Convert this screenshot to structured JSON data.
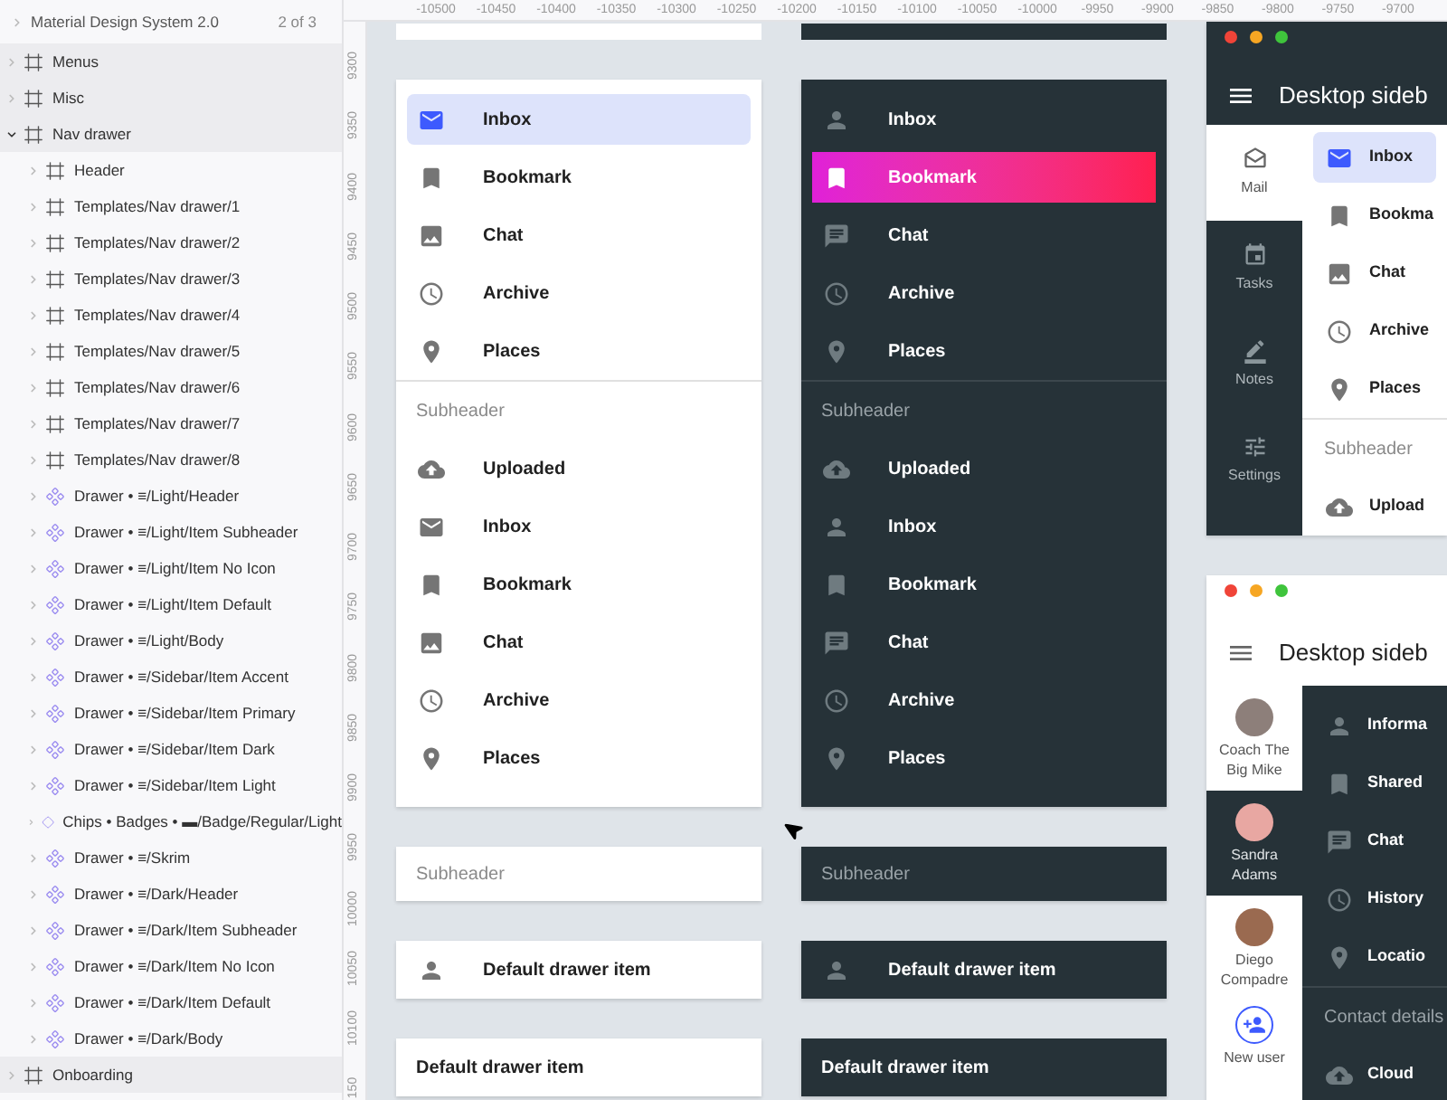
{
  "layers": {
    "title": "Material Design System 2.0",
    "page_count": "2 of 3",
    "items": [
      {
        "kind": "frame",
        "label": "Menus",
        "expanded": false
      },
      {
        "kind": "frame",
        "label": "Misc",
        "expanded": false
      },
      {
        "kind": "frame",
        "label": "Nav drawer",
        "expanded": true,
        "children": [
          {
            "kind": "frame",
            "label": "Header",
            "expanded": false
          },
          {
            "kind": "frame",
            "label": "Templates/Nav drawer/1",
            "expanded": false
          },
          {
            "kind": "frame",
            "label": "Templates/Nav drawer/2",
            "expanded": false
          },
          {
            "kind": "frame",
            "label": "Templates/Nav drawer/3",
            "expanded": false
          },
          {
            "kind": "frame",
            "label": "Templates/Nav drawer/4",
            "expanded": false
          },
          {
            "kind": "frame",
            "label": "Templates/Nav drawer/5",
            "expanded": false
          },
          {
            "kind": "frame",
            "label": "Templates/Nav drawer/6",
            "expanded": false
          },
          {
            "kind": "frame",
            "label": "Templates/Nav drawer/7",
            "expanded": false
          },
          {
            "kind": "frame",
            "label": "Templates/Nav drawer/8",
            "expanded": false
          },
          {
            "kind": "component",
            "label": "Drawer • ≡/Light/Header",
            "expanded": false
          },
          {
            "kind": "component",
            "label": "Drawer • ≡/Light/Item Subheader",
            "expanded": false
          },
          {
            "kind": "component",
            "label": "Drawer • ≡/Light/Item No Icon",
            "expanded": false
          },
          {
            "kind": "component",
            "label": "Drawer • ≡/Light/Item Default",
            "expanded": false
          },
          {
            "kind": "component",
            "label": "Drawer • ≡/Light/Body",
            "expanded": false
          },
          {
            "kind": "component",
            "label": "Drawer • ≡/Sidebar/Item Accent",
            "expanded": false
          },
          {
            "kind": "component",
            "label": "Drawer • ≡/Sidebar/Item Primary",
            "expanded": false
          },
          {
            "kind": "component",
            "label": "Drawer • ≡/Sidebar/Item Dark",
            "expanded": false
          },
          {
            "kind": "component",
            "label": "Drawer • ≡/Sidebar/Item Light",
            "expanded": false
          },
          {
            "kind": "instance",
            "label": "Chips • Badges • ▬/Badge/Regular/Light",
            "expanded": false
          },
          {
            "kind": "component",
            "label": "Drawer • ≡/Skrim",
            "expanded": false
          },
          {
            "kind": "component",
            "label": "Drawer • ≡/Dark/Header",
            "expanded": false
          },
          {
            "kind": "component",
            "label": "Drawer • ≡/Dark/Item Subheader",
            "expanded": false
          },
          {
            "kind": "component",
            "label": "Drawer • ≡/Dark/Item No Icon",
            "expanded": false
          },
          {
            "kind": "component",
            "label": "Drawer • ≡/Dark/Item Default",
            "expanded": false
          },
          {
            "kind": "component",
            "label": "Drawer • ≡/Dark/Body",
            "expanded": false
          }
        ]
      },
      {
        "kind": "frame",
        "label": "Onboarding",
        "expanded": false
      }
    ]
  },
  "ruler_top": {
    "labels": [
      "-10500",
      "-10450",
      "-10400",
      "-10350",
      "-10300",
      "-10250",
      "-10200",
      "-10150",
      "-10100",
      "-10050",
      "-10000",
      "-9950",
      "-9900",
      "-9850",
      "-9800",
      "-9750",
      "-9700"
    ]
  },
  "ruler_left": {
    "labels": [
      "9300",
      "9350",
      "9400",
      "9450",
      "9500",
      "9550",
      "9600",
      "9650",
      "9700",
      "9750",
      "9800",
      "9850",
      "9900",
      "9950",
      "10000",
      "10050",
      "10100",
      "150"
    ]
  },
  "light_drawer": {
    "groups": [
      {
        "items": [
          {
            "label": "Inbox",
            "selected": true
          },
          {
            "label": "Bookmark",
            "selected": false
          },
          {
            "label": "Chat",
            "selected": false
          },
          {
            "label": "Archive",
            "selected": false
          },
          {
            "label": "Places",
            "selected": false
          }
        ]
      },
      {
        "subheader": "Subheader",
        "items": [
          {
            "label": "Uploaded",
            "selected": false
          },
          {
            "label": "Inbox",
            "selected": false
          },
          {
            "label": "Bookmark",
            "selected": false
          },
          {
            "label": "Chat",
            "selected": false
          },
          {
            "label": "Archive",
            "selected": false
          },
          {
            "label": "Places",
            "selected": false
          }
        ]
      }
    ]
  },
  "dark_drawer": {
    "groups": [
      {
        "items": [
          {
            "label": "Inbox",
            "selected": false
          },
          {
            "label": "Bookmark",
            "selected": true
          },
          {
            "label": "Chat",
            "selected": false
          },
          {
            "label": "Archive",
            "selected": false
          },
          {
            "label": "Places",
            "selected": false
          }
        ]
      },
      {
        "subheader": "Subheader",
        "items": [
          {
            "label": "Uploaded",
            "selected": false
          },
          {
            "label": "Inbox",
            "selected": false
          },
          {
            "label": "Bookmark",
            "selected": false
          },
          {
            "label": "Chat",
            "selected": false
          },
          {
            "label": "Archive",
            "selected": false
          },
          {
            "label": "Places",
            "selected": false
          }
        ]
      }
    ]
  },
  "components": {
    "light": [
      {
        "kind": "subheader",
        "label": "Subheader"
      },
      {
        "kind": "icon_item",
        "label": "Default drawer item"
      },
      {
        "kind": "text_item",
        "label": "Default drawer item"
      }
    ],
    "dark": [
      {
        "kind": "subheader",
        "label": "Subheader"
      },
      {
        "kind": "icon_item",
        "label": "Default drawer item"
      },
      {
        "kind": "text_item",
        "label": "Default drawer item"
      }
    ]
  },
  "mail_window": {
    "title": "Desktop sideb",
    "rail": [
      {
        "label": "Mail",
        "selected": true
      },
      {
        "label": "Tasks",
        "selected": false
      },
      {
        "label": "Notes",
        "selected": false
      },
      {
        "label": "Settings",
        "selected": false
      }
    ],
    "groups": [
      {
        "items": [
          {
            "label": "Inbox",
            "selected": true
          },
          {
            "label": "Bookma",
            "selected": false
          },
          {
            "label": "Chat",
            "selected": false
          },
          {
            "label": "Archive",
            "selected": false
          },
          {
            "label": "Places",
            "selected": false
          }
        ]
      },
      {
        "subheader": "Subheader",
        "items": [
          {
            "label": "Upload",
            "selected": false
          }
        ]
      }
    ]
  },
  "contacts_window": {
    "title": "Desktop sideb",
    "rail": [
      {
        "kind": "avatar",
        "label": "Coach The Big Mike",
        "selected": false
      },
      {
        "kind": "avatar",
        "label": "Sandra Adams",
        "selected": true
      },
      {
        "kind": "avatar",
        "label": "Diego Compadre",
        "selected": false
      },
      {
        "kind": "add",
        "label": "New user",
        "selected": false
      }
    ],
    "groups": [
      {
        "items": [
          {
            "label": "Informa",
            "selected": false
          },
          {
            "label": "Shared",
            "selected": false
          },
          {
            "label": "Chat",
            "selected": false
          },
          {
            "label": "History",
            "selected": false
          },
          {
            "label": "Locatio",
            "selected": false
          }
        ]
      },
      {
        "subheader": "Contact details",
        "items": [
          {
            "label": "Cloud",
            "selected": false
          }
        ]
      }
    ]
  }
}
